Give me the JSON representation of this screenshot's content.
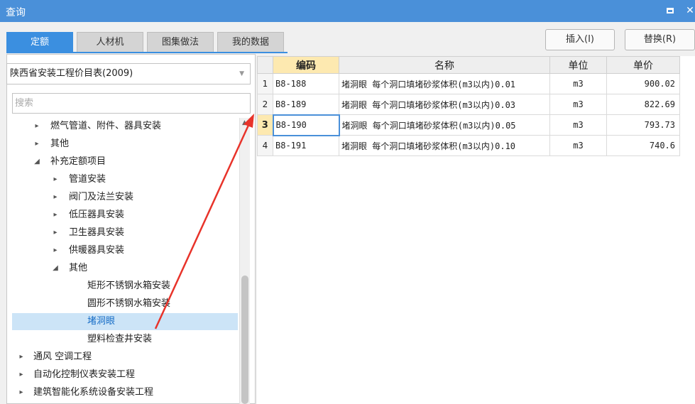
{
  "window": {
    "title": "查询",
    "maximize_icon": "maximize-icon",
    "close_icon": "close-icon",
    "close_glyph": "✕"
  },
  "tabs": [
    {
      "label": "定额",
      "active": true
    },
    {
      "label": "人材机",
      "active": false
    },
    {
      "label": "图集做法",
      "active": false
    },
    {
      "label": "我的数据",
      "active": false
    }
  ],
  "actions": {
    "insert_label": "插入(I)",
    "replace_label": "替换(R)"
  },
  "library_select": {
    "value": "陕西省安装工程价目表(2009)"
  },
  "search": {
    "placeholder": "搜索"
  },
  "tree": [
    {
      "label": "燃气管道、附件、器具安装",
      "caret": "▸"
    },
    {
      "label": "其他",
      "caret": "▸"
    },
    {
      "label": "补充定额项目",
      "caret": "◢"
    },
    {
      "label": "管道安装",
      "caret": "▸"
    },
    {
      "label": "阀门及法兰安装",
      "caret": "▸"
    },
    {
      "label": "低压器具安装",
      "caret": "▸"
    },
    {
      "label": "卫生器具安装",
      "caret": "▸"
    },
    {
      "label": "供暖器具安装",
      "caret": "▸"
    },
    {
      "label": "其他",
      "caret": "◢"
    },
    {
      "label": "矩形不锈钢水箱安装",
      "caret": ""
    },
    {
      "label": "圆形不锈钢水箱安装",
      "caret": ""
    },
    {
      "label": "堵洞眼",
      "caret": "",
      "selected": true
    },
    {
      "label": "塑料检查井安装",
      "caret": ""
    },
    {
      "label": "通风 空调工程",
      "caret": "▸"
    },
    {
      "label": "自动化控制仪表安装工程",
      "caret": "▸"
    },
    {
      "label": "建筑智能化系统设备安装工程",
      "caret": "▸"
    }
  ],
  "table": {
    "columns": [
      "编码",
      "名称",
      "单位",
      "单价"
    ],
    "rows": [
      {
        "num": "1",
        "code": "B8-188",
        "name": "堵洞眼 每个洞口填堵砂浆体积(m3以内)0.01",
        "unit": "m3",
        "price": "900.02"
      },
      {
        "num": "2",
        "code": "B8-189",
        "name": "堵洞眼 每个洞口填堵砂浆体积(m3以内)0.03",
        "unit": "m3",
        "price": "822.69"
      },
      {
        "num": "3",
        "code": "B8-190",
        "name": "堵洞眼 每个洞口填堵砂浆体积(m3以内)0.05",
        "unit": "m3",
        "price": "793.73",
        "current": true
      },
      {
        "num": "4",
        "code": "B8-191",
        "name": "堵洞眼 每个洞口填堵砂浆体积(m3以内)0.10",
        "unit": "m3",
        "price": "740.6"
      }
    ]
  },
  "colors": {
    "accent": "#4a90d9",
    "tab_active": "#3b8fe0",
    "selection": "#cce4f7",
    "header_highlight": "#fde9b0",
    "annotation": "#e8332a"
  }
}
